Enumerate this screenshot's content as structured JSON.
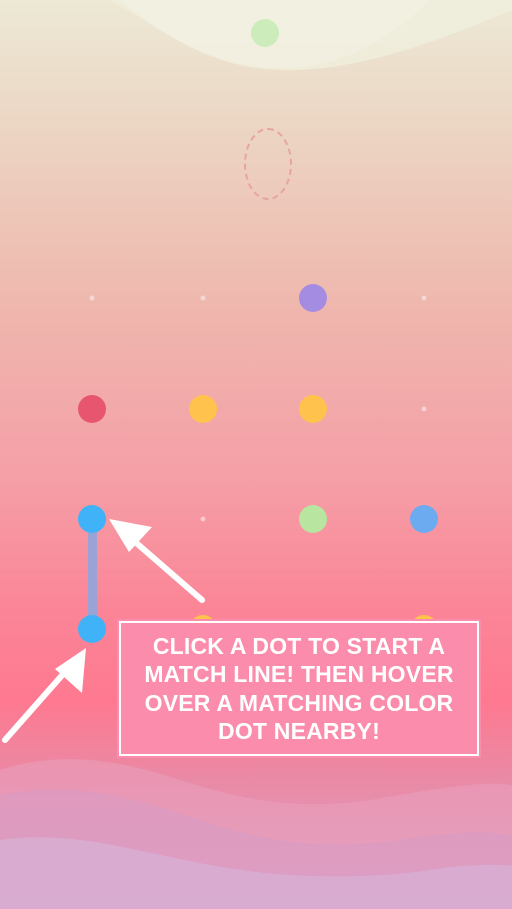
{
  "tutorial": {
    "message": "CLICK A DOT TO START A MATCH LINE! THEN HOVER OVER A MATCHING COLOR DOT NEARBY!"
  },
  "colors": {
    "green": "#b8e6a0",
    "green_light": "#c5ecb4",
    "purple": "#a58ce3",
    "red": "#e8556f",
    "yellow": "#ffc24d",
    "blue": "#3fb2f8",
    "blue_soft": "#6cabf0",
    "line": "#9aa3d4",
    "panel": "#fb8cac"
  },
  "dots": [
    {
      "id": "falling-dot-green",
      "color": "green_light"
    },
    {
      "id": "dot-r1c3-purple",
      "color": "purple"
    },
    {
      "id": "dot-r2c1-red",
      "color": "red"
    },
    {
      "id": "dot-r2c2-yellow",
      "color": "yellow"
    },
    {
      "id": "dot-r2c3-yellow",
      "color": "yellow"
    },
    {
      "id": "dot-r3c1-blue",
      "color": "blue"
    },
    {
      "id": "dot-r3c3-green",
      "color": "green"
    },
    {
      "id": "dot-r3c4-blue",
      "color": "blue_soft"
    },
    {
      "id": "dot-r4c1-blue",
      "color": "blue"
    },
    {
      "id": "dot-r4c2-yellow",
      "color": "yellow"
    },
    {
      "id": "dot-r4c4-yellow",
      "color": "yellow"
    }
  ]
}
